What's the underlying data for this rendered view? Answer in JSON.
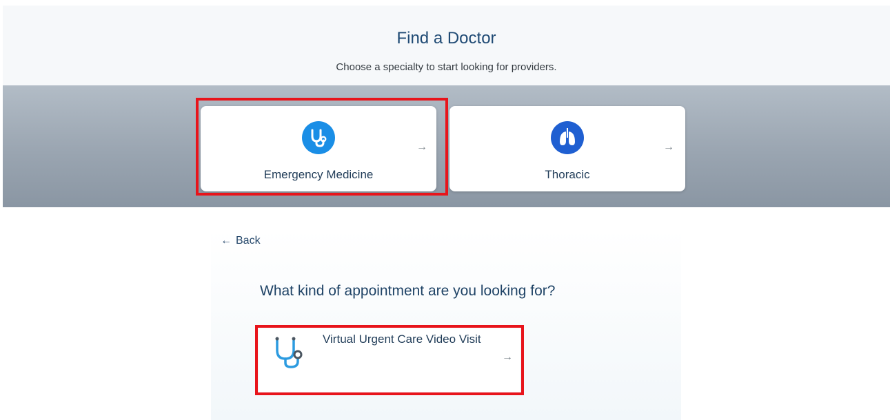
{
  "header": {
    "title": "Find a Doctor",
    "subtitle": "Choose a specialty to start looking for providers."
  },
  "specialties": [
    {
      "label": "Emergency Medicine",
      "icon": "stethoscope-icon",
      "selected": true
    },
    {
      "label": "Thoracic",
      "icon": "lungs-icon",
      "selected": false
    }
  ],
  "arrow_glyph": "→",
  "appointment": {
    "back_label": "Back",
    "back_glyph": "←",
    "question": "What kind of appointment are you looking for?",
    "options": [
      {
        "label": "Virtual Urgent Care Video Visit",
        "icon": "stethoscope-icon",
        "selected": true
      }
    ]
  },
  "colors": {
    "accent_blue": "#1a8ee6",
    "lungs_blue": "#1f5fd1",
    "highlight_red": "#e8141b",
    "title_navy": "#1f4a74"
  }
}
